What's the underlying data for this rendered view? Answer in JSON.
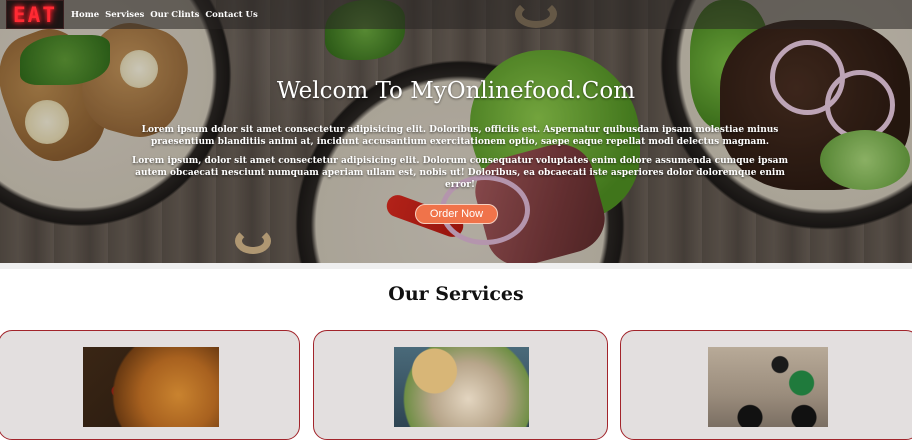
{
  "navbar": {
    "logo_text": "EAT",
    "links": [
      {
        "label": "Home"
      },
      {
        "label": "Servises"
      },
      {
        "label": "Our Clints"
      },
      {
        "label": "Contact Us"
      }
    ]
  },
  "hero": {
    "title": "Welcom To MyOnlinefood.Com",
    "paragraph1": "Lorem ipsum dolor sit amet consectetur adipisicing elit. Doloribus, officiis est. Aspernatur quibusdam ipsam molestiae minus praesentium blanditiis animi at, incidunt accusantium exercitationem optio, saepe eaque repellat modi delectus magnam.",
    "paragraph2": "Lorem ipsum, dolor sit amet consectetur adipisicing elit. Dolorum consequatur voluptates enim dolore assumenda cumque ipsam autem obcaecati nesciunt numquam aperiam ullam est, nobis ut! Doloribus, ea obcaecati iste asperiores dolor doloremque enim error!",
    "button_label": "Order Now",
    "button_color": "#f0734a"
  },
  "services": {
    "title": "Our Services",
    "card_border_color": "#a2242b",
    "cards": [
      {
        "image": "pizza-photo"
      },
      {
        "image": "salad-photo"
      },
      {
        "image": "delivery-scooter-photo"
      }
    ]
  }
}
